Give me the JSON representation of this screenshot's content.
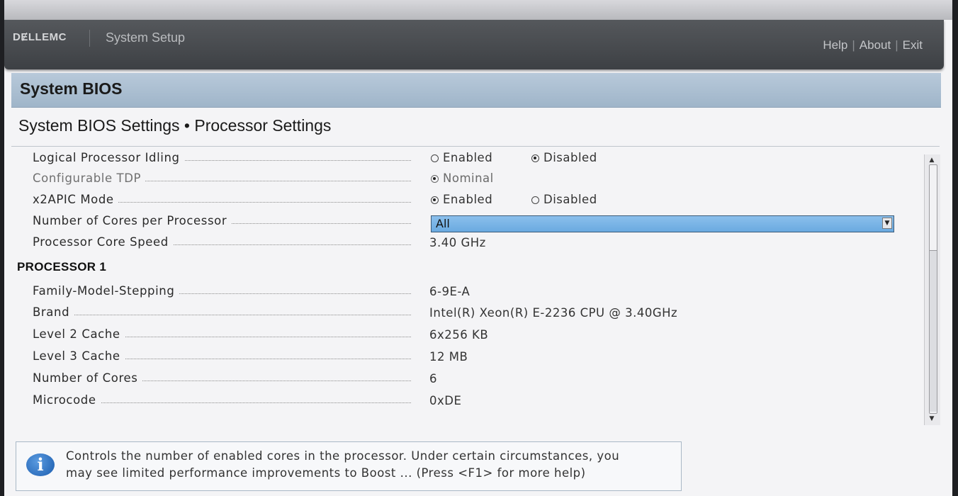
{
  "header": {
    "brand": "DɆLLEMC",
    "title": "System Setup",
    "links": [
      "Help",
      "About",
      "Exit"
    ]
  },
  "page": {
    "title": "System BIOS",
    "section_title": "System BIOS Settings • Processor Settings"
  },
  "settings": {
    "logical_processor_idling": {
      "label": "Logical Processor Idling",
      "options": [
        "Enabled",
        "Disabled"
      ],
      "selected": "Disabled"
    },
    "configurable_tdp": {
      "label": "Configurable TDP",
      "options": [
        "Nominal"
      ],
      "selected": "Nominal"
    },
    "x2apic_mode": {
      "label": "x2APIC Mode",
      "options": [
        "Enabled",
        "Disabled"
      ],
      "selected": "Enabled"
    },
    "cores_per_processor": {
      "label": "Number of Cores per Processor",
      "value": "All"
    },
    "core_speed": {
      "label": "Processor Core Speed",
      "value": "3.40 GHz"
    }
  },
  "processor1": {
    "header": "PROCESSOR 1",
    "rows": [
      {
        "label": "Family-Model-Stepping",
        "value": "6-9E-A"
      },
      {
        "label": "Brand",
        "value": "Intel(R) Xeon(R) E-2236 CPU @ 3.40GHz"
      },
      {
        "label": "Level 2 Cache",
        "value": "6x256 KB"
      },
      {
        "label": "Level 3 Cache",
        "value": "12 MB"
      },
      {
        "label": "Number of Cores",
        "value": "6"
      },
      {
        "label": "Microcode",
        "value": "0xDE"
      }
    ]
  },
  "help": {
    "line1": "Controls the number of enabled cores in the processor. Under certain circumstances, you",
    "line2": "may see limited performance improvements to Boost ... (Press <F1> for more help)"
  },
  "colors": {
    "header_bg": "#45484c",
    "title_band": "#a9bdd0",
    "dropdown_highlight": "#7ab5e6",
    "info_icon": "#2a6cc0"
  }
}
